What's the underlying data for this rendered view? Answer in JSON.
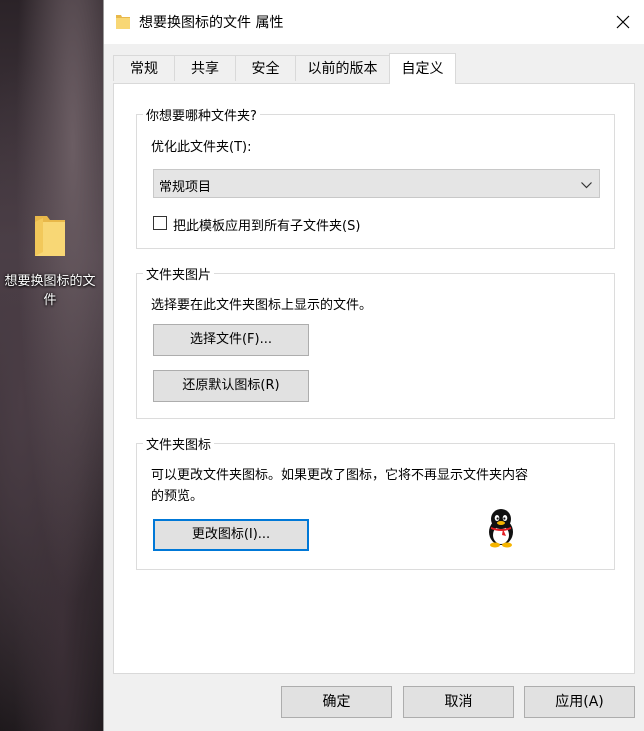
{
  "desktop": {
    "folder_label": "想要换图标的文件",
    "icon": "folder-icon"
  },
  "window": {
    "title": "想要换图标的文件 属性",
    "icons": {
      "title": "folder-icon",
      "close": "close-icon"
    },
    "colors": {
      "accent": "#0078d7",
      "folder": "#f8d775"
    }
  },
  "tabs": [
    {
      "label": "常规",
      "active": false
    },
    {
      "label": "共享",
      "active": false
    },
    {
      "label": "安全",
      "active": false
    },
    {
      "label": "以前的版本",
      "active": false
    },
    {
      "label": "自定义",
      "active": true
    }
  ],
  "optimize": {
    "group_title": "你想要哪种文件夹?",
    "label": "优化此文件夹(T):",
    "selected": "常规项目",
    "checkbox_label": "把此模板应用到所有子文件夹(S)",
    "checkbox_checked": false
  },
  "picture": {
    "group_title": "文件夹图片",
    "description": "选择要在此文件夹图标上显示的文件。",
    "choose_button": "选择文件(F)...",
    "restore_button": "还原默认图标(R)"
  },
  "folder_icon": {
    "group_title": "文件夹图标",
    "description_line1": "可以更改文件夹图标。如果更改了图标，它将不再显示文件夹内容",
    "description_line2": "的预览。",
    "change_button": "更改图标(I)...",
    "preview_icon": "qq-penguin-icon"
  },
  "footer": {
    "ok": "确定",
    "cancel": "取消",
    "apply": "应用(A)"
  }
}
